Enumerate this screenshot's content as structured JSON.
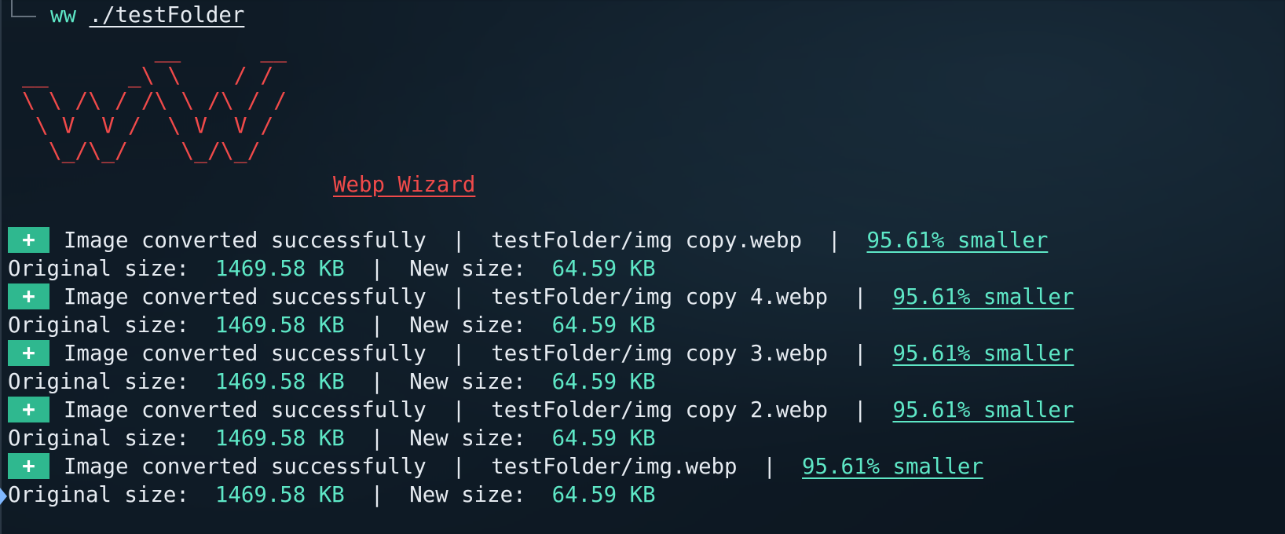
{
  "colors": {
    "background": "#0f1a24",
    "text": "#e6ebf1",
    "accent_teal": "#5ee7c6",
    "ascii_red": "#f04a4a",
    "badge_green": "#2fb88f",
    "cursor_blue": "#7fb7ff"
  },
  "prompt": {
    "command": "ww",
    "argument": "./testFolder"
  },
  "banner": {
    "ascii_lines": [
      "          __      __",
      "__      _\\ \\    / /",
      "\\ \\ /\\ / /\\ \\ /\\ / /",
      " \\ V  V /  \\ V  V /",
      "  \\_/\\_/    \\_/\\_/"
    ],
    "title": "Webp Wizard"
  },
  "results": [
    {
      "badge": "+",
      "status": "Image converted successfully",
      "file": "testFolder/img copy.webp",
      "reduction": "95.61% smaller",
      "original_label": "Original size:",
      "original_size": "1469.58 KB",
      "new_label": "New size:",
      "new_size": "64.59 KB"
    },
    {
      "badge": "+",
      "status": "Image converted successfully",
      "file": "testFolder/img copy 4.webp",
      "reduction": "95.61% smaller",
      "original_label": "Original size:",
      "original_size": "1469.58 KB",
      "new_label": "New size:",
      "new_size": "64.59 KB"
    },
    {
      "badge": "+",
      "status": "Image converted successfully",
      "file": "testFolder/img copy 3.webp",
      "reduction": "95.61% smaller",
      "original_label": "Original size:",
      "original_size": "1469.58 KB",
      "new_label": "New size:",
      "new_size": "64.59 KB"
    },
    {
      "badge": "+",
      "status": "Image converted successfully",
      "file": "testFolder/img copy 2.webp",
      "reduction": "95.61% smaller",
      "original_label": "Original size:",
      "original_size": "1469.58 KB",
      "new_label": "New size:",
      "new_size": "64.59 KB"
    },
    {
      "badge": "+",
      "status": "Image converted successfully",
      "file": "testFolder/img.webp",
      "reduction": "95.61% smaller",
      "original_label": "Original size:",
      "original_size": "1469.58 KB",
      "new_label": "New size:",
      "new_size": "64.59 KB"
    }
  ],
  "separator": "|"
}
